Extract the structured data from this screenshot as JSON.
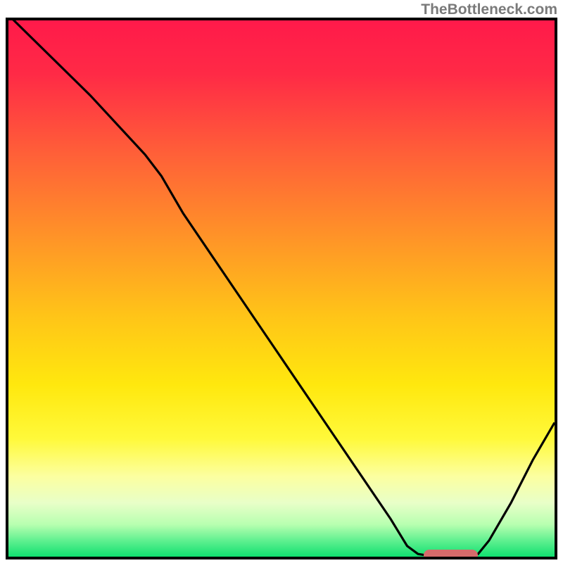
{
  "watermark": "TheBottleneck.com",
  "chart_data": {
    "type": "line",
    "title": "",
    "xlabel": "",
    "ylabel": "",
    "xlim": [
      0,
      100
    ],
    "ylim": [
      0,
      100
    ],
    "curve": [
      {
        "x": 0,
        "y": 101
      },
      {
        "x": 5,
        "y": 96
      },
      {
        "x": 15,
        "y": 86
      },
      {
        "x": 25,
        "y": 75
      },
      {
        "x": 28,
        "y": 71
      },
      {
        "x": 32,
        "y": 64
      },
      {
        "x": 40,
        "y": 52
      },
      {
        "x": 50,
        "y": 37
      },
      {
        "x": 60,
        "y": 22
      },
      {
        "x": 70,
        "y": 7
      },
      {
        "x": 73,
        "y": 2
      },
      {
        "x": 75,
        "y": 0.5
      },
      {
        "x": 78,
        "y": 0
      },
      {
        "x": 84,
        "y": 0
      },
      {
        "x": 86,
        "y": 0.5
      },
      {
        "x": 88,
        "y": 3
      },
      {
        "x": 92,
        "y": 10
      },
      {
        "x": 96,
        "y": 18
      },
      {
        "x": 100,
        "y": 25
      }
    ],
    "marker": {
      "x_start": 76,
      "x_end": 86,
      "y": 0
    },
    "gradient_stops": [
      {
        "pos": 0,
        "color": "#ff1a4a"
      },
      {
        "pos": 10,
        "color": "#ff2a46"
      },
      {
        "pos": 25,
        "color": "#ff6038"
      },
      {
        "pos": 40,
        "color": "#ff9228"
      },
      {
        "pos": 55,
        "color": "#ffc418"
      },
      {
        "pos": 68,
        "color": "#ffe80e"
      },
      {
        "pos": 78,
        "color": "#fff93a"
      },
      {
        "pos": 85,
        "color": "#fcffa0"
      },
      {
        "pos": 90,
        "color": "#e8ffc8"
      },
      {
        "pos": 94,
        "color": "#b8ffb0"
      },
      {
        "pos": 97,
        "color": "#60f090"
      },
      {
        "pos": 100,
        "color": "#10e070"
      }
    ]
  }
}
